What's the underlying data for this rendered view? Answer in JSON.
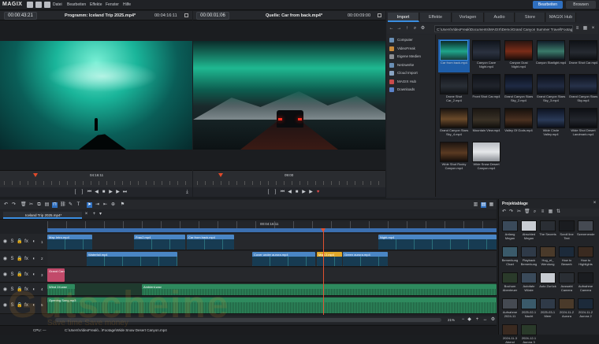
{
  "app": {
    "logo": "MAGIX"
  },
  "menu": [
    "Datei",
    "Bearbeiten",
    "Effekte",
    "Fenster",
    "Hilfe"
  ],
  "top_buttons": {
    "bearbeiten": "Bearbeiten",
    "browsen": "Browsen"
  },
  "program_monitor": {
    "timecode": "00:00:43:21",
    "title": "Programm: Iceland Trip 2025.mp4*",
    "duration": "00:04:16:11",
    "position": "04:16:11"
  },
  "source_monitor": {
    "timecode": "00:00:01:06",
    "title": "Quelle: Car from back.mp4*",
    "duration": "00:00:09:00",
    "position": "09:00"
  },
  "media_tabs": [
    "Import",
    "Effekte",
    "Vorlagen",
    "Audio",
    "Store",
    "MAGIX Hub"
  ],
  "path": "C:\\Users\\VideoFreak\\Documents\\MAGIX\\Demo\\Grand Canyon Summer Travel\\Footage",
  "sources": [
    {
      "label": "Computer",
      "color": "#6a8fb5"
    },
    {
      "label": "VideoFreak",
      "color": "#c98a3a"
    },
    {
      "label": "Eigene Medien",
      "color": "#8c8f94"
    },
    {
      "label": "Netzwerke",
      "color": "#6a8fb5"
    },
    {
      "label": "Cloud Import",
      "color": "#8aa4c2"
    },
    {
      "label": "MAGIX Hub",
      "color": "#c94b4b"
    },
    {
      "label": "Downloads",
      "color": "#5b82c9"
    }
  ],
  "thumbnails": [
    {
      "caption": "Car from back.mp4",
      "bg": "linear-gradient(180deg,#0c2a2a,#1fa58a 55%,#163a38)",
      "selected": true
    },
    {
      "caption": "Canyon Cave Night.mp4",
      "bg": "linear-gradient(180deg,#10141c,#2b3240 60%,#151921)",
      "selected": false
    },
    {
      "caption": "Canyon Dust Night.mp4",
      "bg": "linear-gradient(180deg,#2a1510,#7a2c18 55%,#1a0d0a)",
      "selected": false
    },
    {
      "caption": "Canyon Starlight.mp4",
      "bg": "linear-gradient(180deg,#121e2a,#3a7a6a 55%,#101820)",
      "selected": false
    },
    {
      "caption": "Drone Shot Car.mp4",
      "bg": "linear-gradient(180deg,#0e1116,#262a31 60%,#0d0f12)",
      "selected": false
    },
    {
      "caption": "Drone Shot Car_2.mp4",
      "bg": "linear-gradient(180deg,#12141a,#2a2f37 60%,#101216)",
      "selected": false
    },
    {
      "caption": "Front Shot Car.mp4",
      "bg": "linear-gradient(180deg,#0f1218,#20242c 60%,#0a0c10)",
      "selected": false
    },
    {
      "caption": "Grand Canyon Stars Sky_2.mp4",
      "bg": "linear-gradient(180deg,#0b0f1a,#1e2a44 60%,#0a0d14)",
      "selected": false
    },
    {
      "caption": "Grand Canyon Stars Sky_3.mp4",
      "bg": "linear-gradient(180deg,#0c101a,#222c42 60%,#0b0e15)",
      "selected": false
    },
    {
      "caption": "Grand Canyon Stars Sky.mp4",
      "bg": "linear-gradient(180deg,#0d111b,#27324a 60%,#0b0e16)",
      "selected": false
    },
    {
      "caption": "Grand Canyon Stars Sky_4.mp4",
      "bg": "linear-gradient(180deg,#1a1410,#6a4a2a 55%,#140f0c)",
      "selected": false
    },
    {
      "caption": "Mountain View.mp4",
      "bg": "linear-gradient(180deg,#1a1612,#3a3226 60%,#12100d)",
      "selected": false
    },
    {
      "caption": "Valley Of Gods.mp4",
      "bg": "linear-gradient(180deg,#15100c,#4a3020 60%,#100c09)",
      "selected": false
    },
    {
      "caption": "Wide Circle Valley.mp4",
      "bg": "linear-gradient(180deg,#0d1320,#2a3a58 60%,#0c101a)",
      "selected": false
    },
    {
      "caption": "Wide Shot Desert Landmark.mp4",
      "bg": "linear-gradient(180deg,#0d0f14,#23262d 60%,#0b0c10)",
      "selected": false
    },
    {
      "caption": "Wide Shot Rocky Canyon.mp4",
      "bg": "linear-gradient(180deg,#1d1510,#5a3a22 55%,#140e0a)",
      "selected": false
    },
    {
      "caption": "Wide Snow Desert Canyon.mp4",
      "bg": "linear-gradient(180deg,#b8bcc2,#e6e8ea 50%,#8a8e94)",
      "selected": false
    }
  ],
  "timeline": {
    "tab": "Iceland Trip 2025.mp4*",
    "ruler_time": "00:04:16:11",
    "zoom": "21%",
    "clips": [
      {
        "track": 0,
        "name": "Map Intro.mp4",
        "start": 0,
        "width": 57,
        "color": "#4a86c5"
      },
      {
        "track": 0,
        "name": "Frau2.mp4",
        "start": 110,
        "width": 65,
        "color": "#4a86c5"
      },
      {
        "track": 0,
        "name": "Car from back.mp4",
        "start": 177,
        "width": 60,
        "color": "#4a86c5"
      },
      {
        "track": 0,
        "name": "Night.mp4",
        "start": 420,
        "width": 150,
        "color": "#4a86c5"
      },
      {
        "track": 1,
        "name": "Waterfall.mp4",
        "start": 50,
        "width": 115,
        "color": "#4a86c5"
      },
      {
        "track": 1,
        "name": "Cover under aurora.mp4",
        "start": 260,
        "width": 80,
        "color": "#4a86c5"
      },
      {
        "track": 1,
        "name": "Map 2.mp4",
        "start": 342,
        "width": 32,
        "color": "#e0a82a"
      },
      {
        "track": 1,
        "name": "Green aurora.mp4",
        "start": 375,
        "width": 57,
        "color": "#4a86c5"
      },
      {
        "track": 2,
        "name": "Grand Canyon Title",
        "start": 0,
        "width": 22,
        "color": "#c24a6a"
      },
      {
        "track": 3,
        "name": "Wind 24.wav",
        "start": 0,
        "width": 35,
        "color": "#2e8a5e"
      },
      {
        "track": 3,
        "name": "Ambient.wav",
        "start": 120,
        "width": 450,
        "color": "#2e8a5e"
      },
      {
        "track": 4,
        "name": "Opening Song.mp3",
        "start": 0,
        "width": 570,
        "color": "#2e8a5e"
      }
    ]
  },
  "project_bin": {
    "title": "Projektablage",
    "items": [
      "Anfang Megan",
      "Abschied Megan",
      "The Secrets",
      "Scroll line Text",
      "Szenenende",
      "Bemerkung Chart",
      "Playback Bemerkung",
      "Hug_et_ Wendung",
      "How to Bewerb",
      "How to Highlights",
      "Bochum Abenteuer",
      "Autofahr Wüste",
      "Auto Zurück",
      "Auswahl Camera",
      "Aufnahme Camera",
      "Aufnahme 2024-11",
      "2025-02-1 Nacht",
      "2025-03-1 Meer",
      "2024-11-2 Aurora",
      "2024-11-2 Aurora 2",
      "2024-11-3 Abend",
      "2024-12-1 Aurora 3"
    ]
  },
  "status": {
    "cpu": "CPU: —",
    "path": "C:\\Users\\VideoFreak\\...\\Footage\\Wide Snow Desert Canyon.mp4"
  },
  "watermark": {
    "text": "Gutscheine",
    "sub": "Save time Save money"
  }
}
